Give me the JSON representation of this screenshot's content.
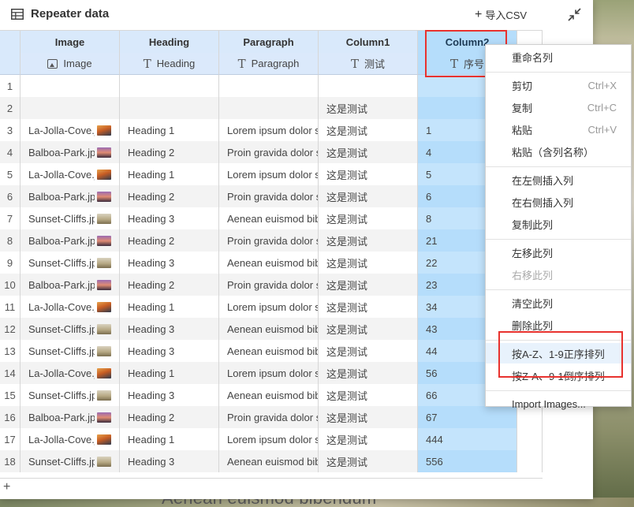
{
  "dialog": {
    "title": "Repeater data",
    "import_label": "导入CSV",
    "add_row": "+"
  },
  "columns": [
    {
      "name": "Image",
      "type_label": "Image",
      "type_icon": "image-icon"
    },
    {
      "name": "Heading",
      "type_label": "Heading",
      "type_icon": "text-icon"
    },
    {
      "name": "Paragraph",
      "type_label": "Paragraph",
      "type_icon": "text-icon"
    },
    {
      "name": "Column1",
      "type_label": "测试",
      "type_icon": "text-icon"
    },
    {
      "name": "Column2",
      "type_label": "序号",
      "type_icon": "text-icon"
    }
  ],
  "rows": [
    {
      "n": "1",
      "image": "",
      "thumb": "",
      "heading": "",
      "paragraph": "",
      "col1": "",
      "col2": ""
    },
    {
      "n": "2",
      "image": "",
      "thumb": "",
      "heading": "",
      "paragraph": "",
      "col1": "这是测试",
      "col2": ""
    },
    {
      "n": "3",
      "image": "La-Jolla-Cove.jpg",
      "thumb": "lajolla",
      "heading": "Heading 1",
      "paragraph": "Lorem ipsum dolor sit amet",
      "col1": "这是测试",
      "col2": "1"
    },
    {
      "n": "4",
      "image": "Balboa-Park.jpg",
      "thumb": "balboa",
      "heading": "Heading 2",
      "paragraph": "Proin gravida dolor sit",
      "col1": "这是测试",
      "col2": "4"
    },
    {
      "n": "5",
      "image": "La-Jolla-Cove.jpg",
      "thumb": "lajolla",
      "heading": "Heading 1",
      "paragraph": "Lorem ipsum dolor sit amet",
      "col1": "这是测试",
      "col2": "5"
    },
    {
      "n": "6",
      "image": "Balboa-Park.jpg",
      "thumb": "balboa",
      "heading": "Heading 2",
      "paragraph": "Proin gravida dolor sit",
      "col1": "这是测试",
      "col2": "6"
    },
    {
      "n": "7",
      "image": "Sunset-Cliffs.jpg",
      "thumb": "sunset",
      "heading": "Heading 3",
      "paragraph": "Aenean euismod bibendum",
      "col1": "这是测试",
      "col2": "8"
    },
    {
      "n": "8",
      "image": "Balboa-Park.jpg",
      "thumb": "balboa",
      "heading": "Heading 2",
      "paragraph": "Proin gravida dolor sit",
      "col1": "这是测试",
      "col2": "21"
    },
    {
      "n": "9",
      "image": "Sunset-Cliffs.jpg",
      "thumb": "sunset",
      "heading": "Heading 3",
      "paragraph": "Aenean euismod bibendum",
      "col1": "这是测试",
      "col2": "22"
    },
    {
      "n": "10",
      "image": "Balboa-Park.jpg",
      "thumb": "balboa",
      "heading": "Heading 2",
      "paragraph": "Proin gravida dolor sit",
      "col1": "这是测试",
      "col2": "23"
    },
    {
      "n": "11",
      "image": "La-Jolla-Cove.jpg",
      "thumb": "lajolla",
      "heading": "Heading 1",
      "paragraph": "Lorem ipsum dolor sit amet",
      "col1": "这是测试",
      "col2": "34"
    },
    {
      "n": "12",
      "image": "Sunset-Cliffs.jpg",
      "thumb": "sunset",
      "heading": "Heading 3",
      "paragraph": "Aenean euismod bibendum",
      "col1": "这是测试",
      "col2": "43"
    },
    {
      "n": "13",
      "image": "Sunset-Cliffs.jpg",
      "thumb": "sunset",
      "heading": "Heading 3",
      "paragraph": "Aenean euismod bibendum",
      "col1": "这是测试",
      "col2": "44"
    },
    {
      "n": "14",
      "image": "La-Jolla-Cove.jpg",
      "thumb": "lajolla",
      "heading": "Heading 1",
      "paragraph": "Lorem ipsum dolor sit amet",
      "col1": "这是测试",
      "col2": "56"
    },
    {
      "n": "15",
      "image": "Sunset-Cliffs.jpg",
      "thumb": "sunset",
      "heading": "Heading 3",
      "paragraph": "Aenean euismod bibendum",
      "col1": "这是测试",
      "col2": "66"
    },
    {
      "n": "16",
      "image": "Balboa-Park.jpg",
      "thumb": "balboa",
      "heading": "Heading 2",
      "paragraph": "Proin gravida dolor sit",
      "col1": "这是测试",
      "col2": "67"
    },
    {
      "n": "17",
      "image": "La-Jolla-Cove.jpg",
      "thumb": "lajolla",
      "heading": "Heading 1",
      "paragraph": "Lorem ipsum dolor sit amet",
      "col1": "这是测试",
      "col2": "444"
    },
    {
      "n": "18",
      "image": "Sunset-Cliffs.jpg",
      "thumb": "sunset",
      "heading": "Heading 3",
      "paragraph": "Aenean euismod bibendum",
      "col1": "这是测试",
      "col2": "556"
    }
  ],
  "context_menu": {
    "items": [
      {
        "label": "重命名列",
        "shortcut": "",
        "disabled": false,
        "name": "rename-column"
      },
      {
        "sep": true
      },
      {
        "label": "剪切",
        "shortcut": "Ctrl+X",
        "disabled": false,
        "name": "cut"
      },
      {
        "label": "复制",
        "shortcut": "Ctrl+C",
        "disabled": false,
        "name": "copy"
      },
      {
        "label": "粘贴",
        "shortcut": "Ctrl+V",
        "disabled": false,
        "name": "paste"
      },
      {
        "label": "粘贴（含列名称）",
        "shortcut": "",
        "disabled": false,
        "name": "paste-with-header"
      },
      {
        "sep": true
      },
      {
        "label": "在左侧插入列",
        "shortcut": "",
        "disabled": false,
        "name": "insert-left"
      },
      {
        "label": "在右侧插入列",
        "shortcut": "",
        "disabled": false,
        "name": "insert-right"
      },
      {
        "label": "复制此列",
        "shortcut": "",
        "disabled": false,
        "name": "duplicate-column"
      },
      {
        "sep": true
      },
      {
        "label": "左移此列",
        "shortcut": "",
        "disabled": false,
        "name": "move-left"
      },
      {
        "label": "右移此列",
        "shortcut": "",
        "disabled": true,
        "name": "move-right"
      },
      {
        "sep": true
      },
      {
        "label": "清空此列",
        "shortcut": "",
        "disabled": false,
        "name": "clear-column"
      },
      {
        "label": "删除此列",
        "shortcut": "",
        "disabled": false,
        "name": "delete-column"
      },
      {
        "sep": true
      },
      {
        "label": "按A-Z、1-9正序排列",
        "shortcut": "",
        "disabled": false,
        "name": "sort-ascending",
        "highlight": true
      },
      {
        "label": "按Z-A、9-1倒序排列",
        "shortcut": "",
        "disabled": false,
        "name": "sort-descending"
      },
      {
        "sep": true
      },
      {
        "label": "Import Images...",
        "shortcut": "",
        "disabled": false,
        "name": "import-images"
      }
    ]
  },
  "background": {
    "caption": "Aenean euismod bibendum"
  },
  "colors": {
    "selected_column": "#b5ddfb",
    "header_bg": "#d9e9fb",
    "annotation_red": "#e8322e"
  }
}
